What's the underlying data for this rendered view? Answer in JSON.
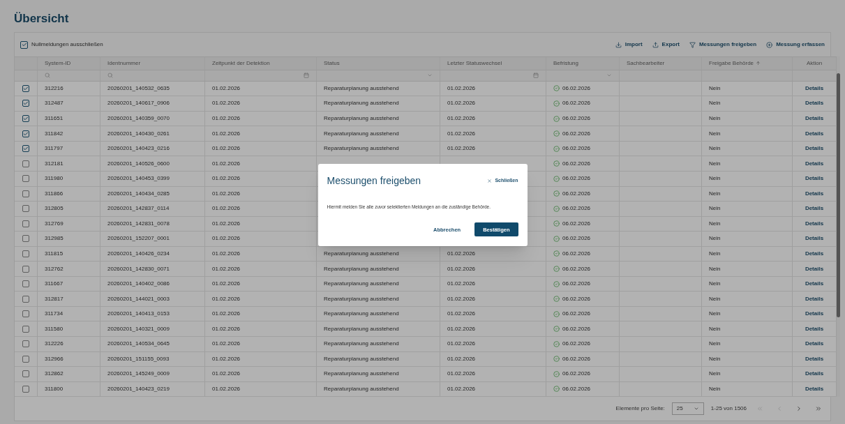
{
  "title": "Übersicht",
  "filter_checkbox": {
    "label": "Nullmeldungen ausschließen",
    "checked": true
  },
  "toolbar": [
    {
      "kind": "import",
      "label": "Import"
    },
    {
      "kind": "export",
      "label": "Export"
    },
    {
      "kind": "release",
      "label": "Messungen freigeben"
    },
    {
      "kind": "add",
      "label": "Messung erfassen"
    }
  ],
  "table": {
    "columns": [
      {
        "label": "System-ID",
        "kind": "search"
      },
      {
        "label": "Identnummer",
        "kind": "search"
      },
      {
        "label": "Zeitpunkt der Detektion",
        "kind": "date"
      },
      {
        "label": "Status",
        "kind": "select"
      },
      {
        "label": "Letzter Statuswechsel",
        "kind": "date"
      },
      {
        "label": "Befristung",
        "kind": "select"
      },
      {
        "label": "Sachbearbeiter",
        "kind": "plain"
      },
      {
        "label": "Freigabe Behörde",
        "kind": "plain",
        "sorted": true
      },
      {
        "label": "Aktion",
        "kind": "plain"
      }
    ],
    "rows": [
      {
        "checked": true,
        "id": "312216",
        "ident": "20260201_140532_0635",
        "detected": "01.02.2026",
        "status": "Reparaturplanung ausstehend",
        "last_change": "01.02.2026",
        "deadline": "06.02.2026",
        "release": "Nein",
        "action": "Details"
      },
      {
        "checked": true,
        "id": "312487",
        "ident": "20260201_140617_0906",
        "detected": "01.02.2026",
        "status": "Reparaturplanung ausstehend",
        "last_change": "01.02.2026",
        "deadline": "06.02.2026",
        "release": "Nein",
        "action": "Details"
      },
      {
        "checked": true,
        "id": "311651",
        "ident": "20260201_140359_0070",
        "detected": "01.02.2026",
        "status": "Reparaturplanung ausstehend",
        "last_change": "01.02.2026",
        "deadline": "06.02.2026",
        "release": "Nein",
        "action": "Details"
      },
      {
        "checked": true,
        "id": "311842",
        "ident": "20260201_140430_0261",
        "detected": "01.02.2026",
        "status": "Reparaturplanung ausstehend",
        "last_change": "01.02.2026",
        "deadline": "06.02.2026",
        "release": "Nein",
        "action": "Details"
      },
      {
        "checked": true,
        "id": "311797",
        "ident": "20260201_140423_0216",
        "detected": "01.02.2026",
        "status": "Reparaturplanung ausstehend",
        "last_change": "01.02.2026",
        "deadline": "06.02.2026",
        "release": "Nein",
        "action": "Details"
      },
      {
        "checked": false,
        "id": "312181",
        "ident": "20260201_140526_0600",
        "detected": "01.02.2026",
        "deadline": "06.02.2026",
        "release": "Nein",
        "action": "Details"
      },
      {
        "checked": false,
        "id": "311980",
        "ident": "20260201_140453_0399",
        "detected": "01.02.2026",
        "deadline": "06.02.2026",
        "release": "Nein",
        "action": "Details"
      },
      {
        "checked": false,
        "id": "311866",
        "ident": "20260201_140434_0285",
        "detected": "01.02.2026",
        "deadline": "06.02.2026",
        "release": "Nein",
        "action": "Details"
      },
      {
        "checked": false,
        "id": "312805",
        "ident": "20260201_142837_0114",
        "detected": "01.02.2026",
        "deadline": "06.02.2026",
        "release": "Nein",
        "action": "Details"
      },
      {
        "checked": false,
        "id": "312769",
        "ident": "20260201_142831_0078",
        "detected": "01.02.2026",
        "deadline": "06.02.2026",
        "release": "Nein",
        "action": "Details"
      },
      {
        "checked": false,
        "id": "312985",
        "ident": "20260201_152207_0001",
        "detected": "01.02.2026",
        "deadline": "06.02.2026",
        "release": "Nein",
        "action": "Details"
      },
      {
        "checked": false,
        "id": "311815",
        "ident": "20260201_140426_0234",
        "detected": "01.02.2026",
        "status": "Reparaturplanung ausstehend",
        "last_change": "01.02.2026",
        "deadline": "06.02.2026",
        "release": "Nein",
        "action": "Details"
      },
      {
        "checked": false,
        "id": "312762",
        "ident": "20260201_142830_0071",
        "detected": "01.02.2026",
        "status": "Reparaturplanung ausstehend",
        "last_change": "01.02.2026",
        "deadline": "06.02.2026",
        "release": "Nein",
        "action": "Details"
      },
      {
        "checked": false,
        "id": "311667",
        "ident": "20260201_140402_0086",
        "detected": "01.02.2026",
        "status": "Reparaturplanung ausstehend",
        "last_change": "01.02.2026",
        "deadline": "06.02.2026",
        "release": "Nein",
        "action": "Details"
      },
      {
        "checked": false,
        "id": "312817",
        "ident": "20260201_144021_0003",
        "detected": "01.02.2026",
        "status": "Reparaturplanung ausstehend",
        "last_change": "01.02.2026",
        "deadline": "06.02.2026",
        "release": "Nein",
        "action": "Details"
      },
      {
        "checked": false,
        "id": "311734",
        "ident": "20260201_140413_0153",
        "detected": "01.02.2026",
        "status": "Reparaturplanung ausstehend",
        "last_change": "01.02.2026",
        "deadline": "06.02.2026",
        "release": "Nein",
        "action": "Details"
      },
      {
        "checked": false,
        "id": "311580",
        "ident": "20260201_140321_0009",
        "detected": "01.02.2026",
        "status": "Reparaturplanung ausstehend",
        "last_change": "01.02.2026",
        "deadline": "06.02.2026",
        "release": "Nein",
        "action": "Details"
      },
      {
        "checked": false,
        "id": "312226",
        "ident": "20260201_140534_0645",
        "detected": "01.02.2026",
        "status": "Reparaturplanung ausstehend",
        "last_change": "01.02.2026",
        "deadline": "06.02.2026",
        "release": "Nein",
        "action": "Details"
      },
      {
        "checked": false,
        "id": "312966",
        "ident": "20260201_151155_0093",
        "detected": "01.02.2026",
        "status": "Reparaturplanung ausstehend",
        "last_change": "01.02.2026",
        "deadline": "06.02.2026",
        "release": "Nein",
        "action": "Details"
      },
      {
        "checked": false,
        "id": "312862",
        "ident": "20260201_145249_0009",
        "detected": "01.02.2026",
        "status": "Reparaturplanung ausstehend",
        "last_change": "01.02.2026",
        "deadline": "06.02.2026",
        "release": "Nein",
        "action": "Details"
      },
      {
        "checked": false,
        "id": "311800",
        "ident": "20260201_140423_0219",
        "detected": "01.02.2026",
        "status": "Reparaturplanung ausstehend",
        "last_change": "01.02.2026",
        "deadline": "06.02.2026",
        "release": "Nein",
        "action": "Details"
      }
    ]
  },
  "pagination": {
    "page_size_label": "Elemente pro Seite:",
    "page_size": "25",
    "range": "1-25 von 1506",
    "first_disabled": true,
    "prev_disabled": true,
    "next_disabled": false,
    "last_disabled": false
  },
  "dialog": {
    "title": "Messungen freigeben",
    "close": "Schließen",
    "message": "Hiermit melden Sie alle zuvor selektierten Meldungen an die zuständige Behörde.",
    "cancel": "Abbrechen",
    "confirm": "Bestätigen"
  }
}
